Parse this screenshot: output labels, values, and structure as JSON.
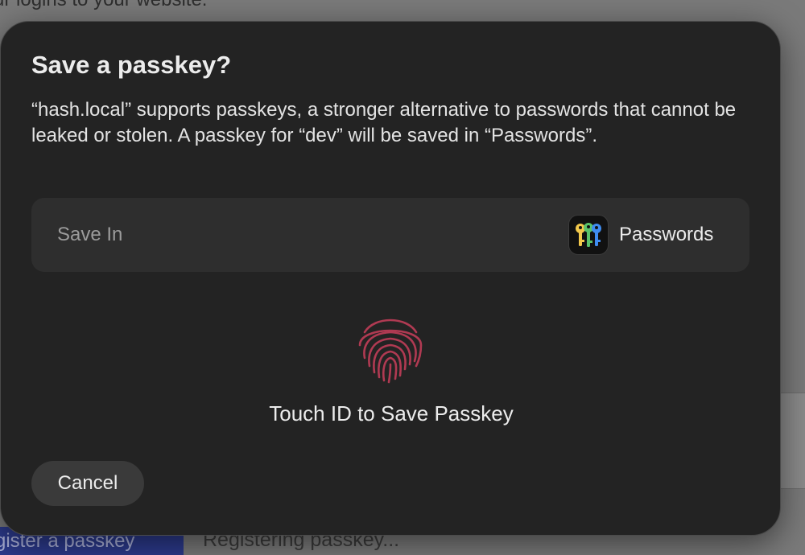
{
  "background": {
    "top_text": "ur logins to your website.",
    "bottom_button_label": "gister a passkey",
    "bottom_status": "Registering passkey..."
  },
  "dialog": {
    "title": "Save a passkey?",
    "description": "“hash.local” supports passkeys, a stronger alternative to passwords that cannot be leaked or stolen. A passkey for “dev” will be saved in “Passwords”.",
    "save_in": {
      "label": "Save In",
      "app_icon": "passwords-keys-icon",
      "app_name": "Passwords"
    },
    "touch_id": {
      "icon": "fingerprint-icon",
      "label": "Touch ID to Save Passkey",
      "color": "#b03a52"
    },
    "cancel_label": "Cancel"
  }
}
